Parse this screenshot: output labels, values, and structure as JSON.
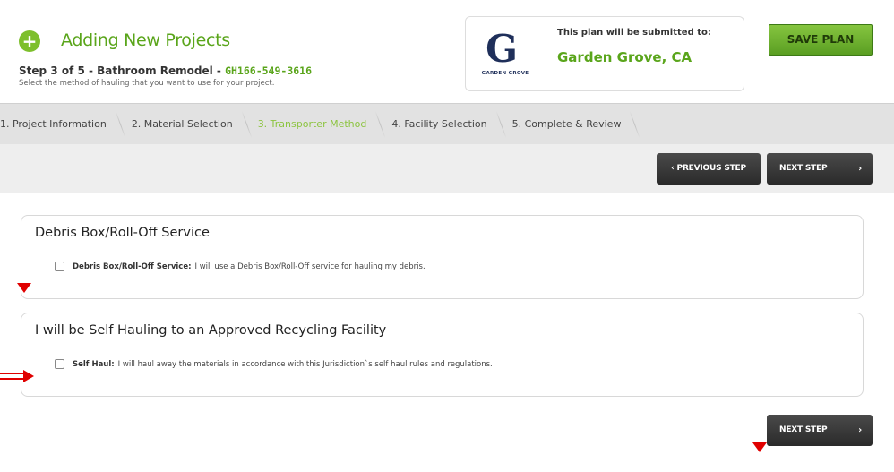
{
  "header": {
    "title": "Adding New Projects",
    "step_text": "Step 3 of 5 - Bathroom Remodel",
    "separator": " - ",
    "plan_id": "GH166-549-3616",
    "help_text": "Select the method of hauling that you want to use for your project.",
    "add_icon": "plus-circle-icon",
    "accent_color": "#5aa51b"
  },
  "jurisdiction": {
    "submitted_label": "This plan will be submitted to:",
    "city": "Garden Grove, CA",
    "logo_letter": "G",
    "logo_text": "GARDEN GROVE"
  },
  "save_button": "SAVE PLAN",
  "steps": [
    {
      "label": "1. Project Information",
      "active": false
    },
    {
      "label": "2. Material Selection",
      "active": false
    },
    {
      "label": "3. Transporter Method",
      "active": true
    },
    {
      "label": "4. Facility Selection",
      "active": false
    },
    {
      "label": "5. Complete & Review",
      "active": false
    }
  ],
  "nav": {
    "prev_label": "‹ PREVIOUS STEP",
    "next_label": "NEXT STEP",
    "next_chevron": "›"
  },
  "options": [
    {
      "title": "Debris Box/Roll-Off Service",
      "label": "Debris Box/Roll-Off Service:",
      "description": "I will use a Debris Box/Roll-Off service for hauling my debris.",
      "checked": false
    },
    {
      "title": "I will be Self Hauling to an Approved Recycling Facility",
      "label": "Self Haul:",
      "description": "I will haul away the materials in accordance with this Jurisdiction`s self haul rules and regulations.",
      "checked": false
    }
  ],
  "annotation_color": "#e00000"
}
